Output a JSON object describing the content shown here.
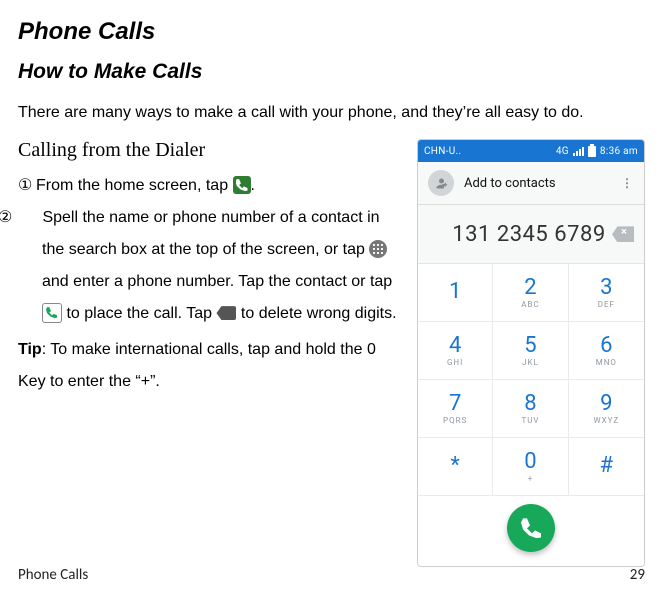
{
  "h1": "Phone Calls",
  "h2": "How to Make Calls",
  "intro": "There are many ways to make a call with your phone, and they’re all easy to do.",
  "h3": "Calling from the Dialer",
  "step1_num": "①",
  "step1_a": "From the home screen, tap ",
  "step1_b": ".",
  "step2_num": "②",
  "step2_a": " Spell the name or phone number of a contact in the search box at the top of the screen, or tap  ",
  "step2_b": " and enter a phone number. Tap the contact or tap ",
  "step2_c": " to place the call. Tap ",
  "step2_d": "  to delete wrong digits.",
  "tip_label": "Tip",
  "tip_text": ": To make international calls, tap and hold the 0 Key to enter the “+”.",
  "footer_left": "Phone Calls",
  "footer_right": "29",
  "mock": {
    "status": {
      "carrier": "CHN-U..",
      "net": "4G",
      "time": "8:36 am"
    },
    "add_contacts": "Add to contacts",
    "display_number": "131 2345 6789",
    "keys": [
      {
        "d": "1",
        "s": ""
      },
      {
        "d": "2",
        "s": "ABC"
      },
      {
        "d": "3",
        "s": "DEF"
      },
      {
        "d": "4",
        "s": "GHI"
      },
      {
        "d": "5",
        "s": "JKL"
      },
      {
        "d": "6",
        "s": "MNO"
      },
      {
        "d": "7",
        "s": "PQRS"
      },
      {
        "d": "8",
        "s": "TUV"
      },
      {
        "d": "9",
        "s": "WXYZ"
      },
      {
        "d": "*",
        "s": ""
      },
      {
        "d": "0",
        "s": "+"
      },
      {
        "d": "#",
        "s": ""
      }
    ]
  }
}
